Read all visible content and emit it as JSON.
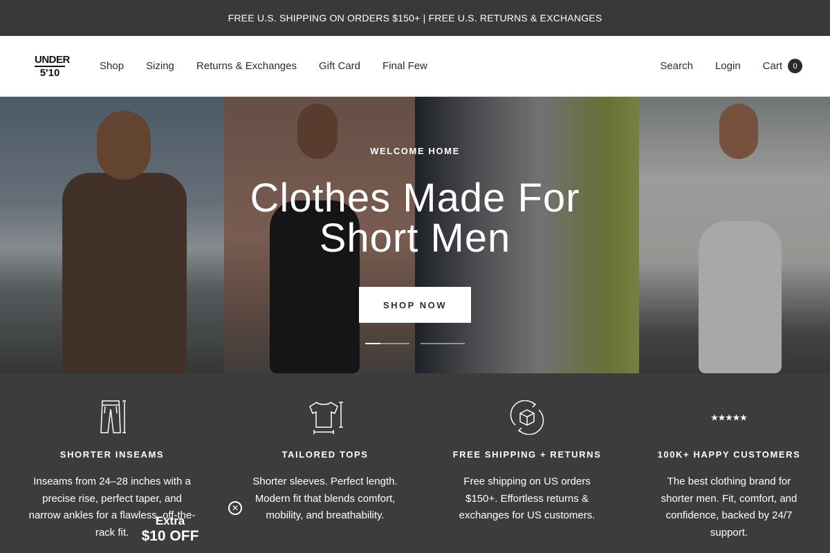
{
  "announcement": "FREE U.S. SHIPPING ON ORDERS $150+ | FREE U.S. RETURNS & EXCHANGES",
  "logo": {
    "line1": "UNDER",
    "line2": "5'10"
  },
  "nav": [
    "Shop",
    "Sizing",
    "Returns & Exchanges",
    "Gift Card",
    "Final Few"
  ],
  "right_nav": {
    "search": "Search",
    "login": "Login",
    "cart": "Cart",
    "cart_count": "0"
  },
  "hero": {
    "eyebrow": "WELCOME HOME",
    "title_line1": "Clothes Made For",
    "title_line2": "Short Men",
    "cta": "SHOP NOW",
    "slides_total": 2,
    "active_slide": 1
  },
  "features": [
    {
      "icon": "pants-icon",
      "title": "SHORTER INSEAMS",
      "text": "Inseams from 24–28 inches with a precise rise, perfect taper, and narrow ankles for a flawless, off-the-rack fit."
    },
    {
      "icon": "tshirt-icon",
      "title": "TAILORED TOPS",
      "text": "Shorter sleeves. Perfect length. Modern fit that blends comfort, mobility, and breathability."
    },
    {
      "icon": "box-return-icon",
      "title": "FREE SHIPPING + RETURNS",
      "text": "Free shipping on US orders $150+. Effortless returns & exchanges for US customers."
    },
    {
      "icon": "stars-icon",
      "title": "100K+ HAPPY CUSTOMERS",
      "text": "The best clothing brand for shorter men. Fit, comfort, and confidence, backed by 24/7 support."
    }
  ],
  "promo": {
    "line1": "Extra",
    "line2": "$10 OFF"
  },
  "colors": {
    "announcement_bg": "#3a3939",
    "feature_bg": "#3d3c3c",
    "accent": "#2b2b2b"
  }
}
